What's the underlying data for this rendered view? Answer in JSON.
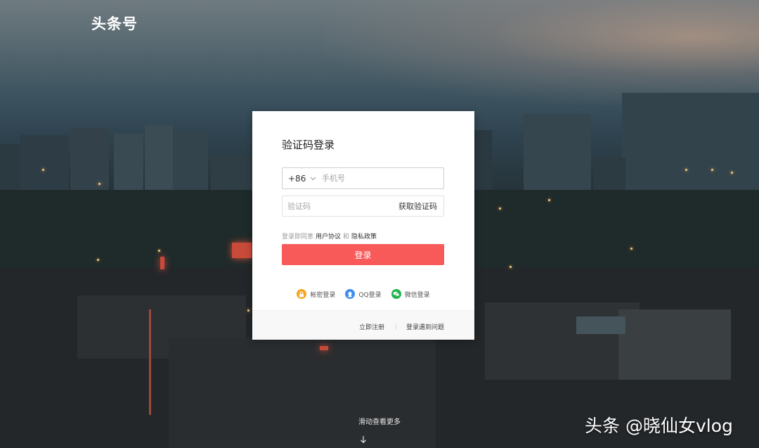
{
  "header": {
    "logo": "头条号"
  },
  "login": {
    "title": "验证码登录",
    "country_code": "+86",
    "phone_placeholder": "手机号",
    "code_placeholder": "验证码",
    "get_code_label": "获取验证码",
    "agree_prefix": "登录即同意",
    "user_agreement": "用户协议",
    "and": "和",
    "privacy_policy": "隐私政策",
    "submit_label": "登录",
    "alt_logins": [
      {
        "label": "帐密登录",
        "icon": "lock-icon",
        "color": "#f5a623"
      },
      {
        "label": "QQ登录",
        "icon": "qq-icon",
        "color": "#3d8ef0"
      },
      {
        "label": "微信登录",
        "icon": "wechat-icon",
        "color": "#20b54d"
      }
    ],
    "footer": {
      "register": "立即注册",
      "trouble": "登录遇到问题"
    }
  },
  "scroll_hint": "滑动查看更多",
  "watermark": "头条 @晓仙女vlog",
  "colors": {
    "primary_button": "#f85959",
    "card_background": "#ffffff"
  }
}
